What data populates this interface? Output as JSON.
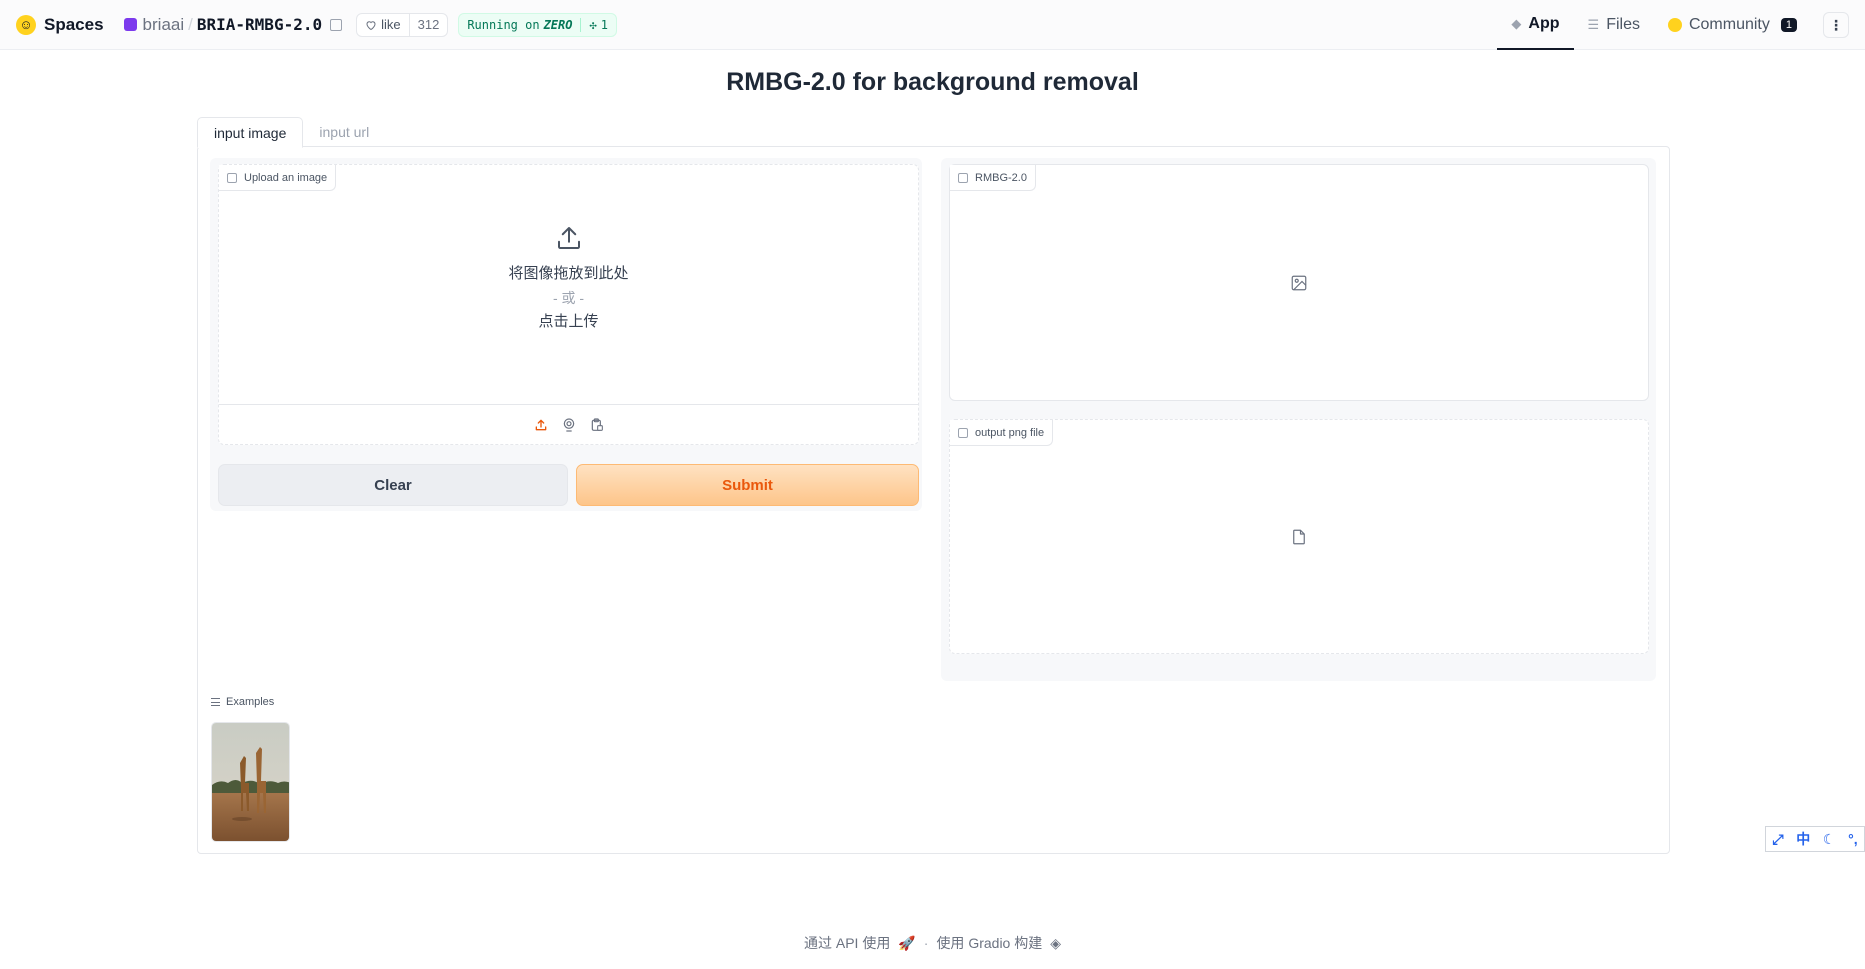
{
  "header": {
    "brand": "Spaces",
    "org": "briaai",
    "separator": "/",
    "repo": "BRIA-RMBG-2.0",
    "like_label": "like",
    "like_count": "312",
    "running_prefix": "Running on",
    "running_hw": "ZERO",
    "running_count": "1",
    "nav": [
      {
        "label": "App",
        "icon": "app-cube-icon",
        "active": true
      },
      {
        "label": "Files",
        "icon": "files-icon",
        "active": false
      },
      {
        "label": "Community",
        "icon": "community-icon",
        "badge": "1",
        "active": false
      }
    ],
    "more": "⋮"
  },
  "title": "RMBG-2.0 for background removal",
  "tabs": [
    {
      "label": "input image",
      "active": true
    },
    {
      "label": "input url",
      "active": false
    }
  ],
  "input": {
    "label": "Upload an image",
    "drop_text": "将图像拖放到此处",
    "or_text": "- 或 -",
    "click_text": "点击上传",
    "sources": [
      "upload-icon",
      "webcam-icon",
      "clipboard-icon"
    ]
  },
  "buttons": {
    "clear": "Clear",
    "submit": "Submit"
  },
  "outputs": {
    "image_label": "RMBG-2.0",
    "file_label": "output png file"
  },
  "examples": {
    "label": "Examples",
    "items": [
      "giraffe-example"
    ]
  },
  "footer": {
    "api_text": "通过 API 使用",
    "dot": "·",
    "built_text": "使用 Gradio 构建"
  },
  "ime": {
    "mode": "中"
  },
  "colors": {
    "accent": "#ea580c",
    "submit_bg": "#fdc58a",
    "running_green": "#047857"
  }
}
